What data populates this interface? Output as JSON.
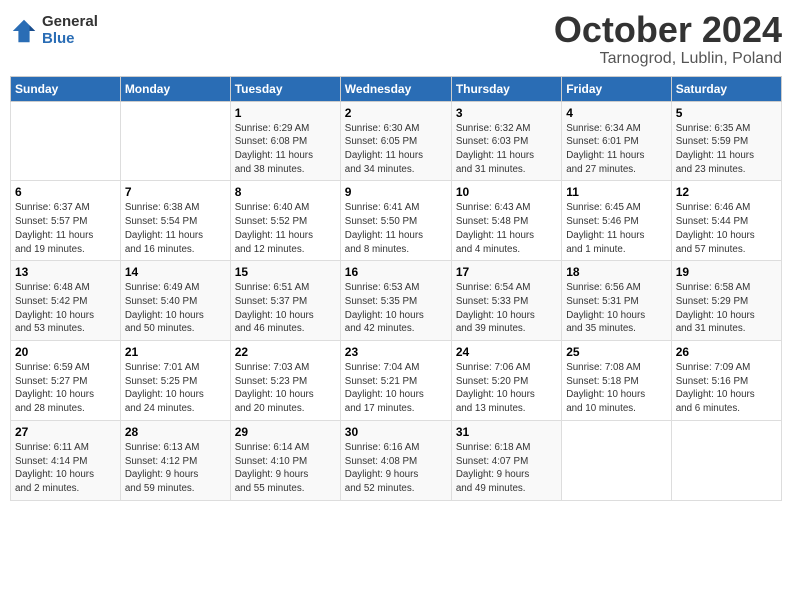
{
  "header": {
    "logo_general": "General",
    "logo_blue": "Blue",
    "title": "October 2024",
    "location": "Tarnogrod, Lublin, Poland"
  },
  "weekdays": [
    "Sunday",
    "Monday",
    "Tuesday",
    "Wednesday",
    "Thursday",
    "Friday",
    "Saturday"
  ],
  "weeks": [
    [
      {
        "day": "",
        "info": ""
      },
      {
        "day": "",
        "info": ""
      },
      {
        "day": "1",
        "info": "Sunrise: 6:29 AM\nSunset: 6:08 PM\nDaylight: 11 hours\nand 38 minutes."
      },
      {
        "day": "2",
        "info": "Sunrise: 6:30 AM\nSunset: 6:05 PM\nDaylight: 11 hours\nand 34 minutes."
      },
      {
        "day": "3",
        "info": "Sunrise: 6:32 AM\nSunset: 6:03 PM\nDaylight: 11 hours\nand 31 minutes."
      },
      {
        "day": "4",
        "info": "Sunrise: 6:34 AM\nSunset: 6:01 PM\nDaylight: 11 hours\nand 27 minutes."
      },
      {
        "day": "5",
        "info": "Sunrise: 6:35 AM\nSunset: 5:59 PM\nDaylight: 11 hours\nand 23 minutes."
      }
    ],
    [
      {
        "day": "6",
        "info": "Sunrise: 6:37 AM\nSunset: 5:57 PM\nDaylight: 11 hours\nand 19 minutes."
      },
      {
        "day": "7",
        "info": "Sunrise: 6:38 AM\nSunset: 5:54 PM\nDaylight: 11 hours\nand 16 minutes."
      },
      {
        "day": "8",
        "info": "Sunrise: 6:40 AM\nSunset: 5:52 PM\nDaylight: 11 hours\nand 12 minutes."
      },
      {
        "day": "9",
        "info": "Sunrise: 6:41 AM\nSunset: 5:50 PM\nDaylight: 11 hours\nand 8 minutes."
      },
      {
        "day": "10",
        "info": "Sunrise: 6:43 AM\nSunset: 5:48 PM\nDaylight: 11 hours\nand 4 minutes."
      },
      {
        "day": "11",
        "info": "Sunrise: 6:45 AM\nSunset: 5:46 PM\nDaylight: 11 hours\nand 1 minute."
      },
      {
        "day": "12",
        "info": "Sunrise: 6:46 AM\nSunset: 5:44 PM\nDaylight: 10 hours\nand 57 minutes."
      }
    ],
    [
      {
        "day": "13",
        "info": "Sunrise: 6:48 AM\nSunset: 5:42 PM\nDaylight: 10 hours\nand 53 minutes."
      },
      {
        "day": "14",
        "info": "Sunrise: 6:49 AM\nSunset: 5:40 PM\nDaylight: 10 hours\nand 50 minutes."
      },
      {
        "day": "15",
        "info": "Sunrise: 6:51 AM\nSunset: 5:37 PM\nDaylight: 10 hours\nand 46 minutes."
      },
      {
        "day": "16",
        "info": "Sunrise: 6:53 AM\nSunset: 5:35 PM\nDaylight: 10 hours\nand 42 minutes."
      },
      {
        "day": "17",
        "info": "Sunrise: 6:54 AM\nSunset: 5:33 PM\nDaylight: 10 hours\nand 39 minutes."
      },
      {
        "day": "18",
        "info": "Sunrise: 6:56 AM\nSunset: 5:31 PM\nDaylight: 10 hours\nand 35 minutes."
      },
      {
        "day": "19",
        "info": "Sunrise: 6:58 AM\nSunset: 5:29 PM\nDaylight: 10 hours\nand 31 minutes."
      }
    ],
    [
      {
        "day": "20",
        "info": "Sunrise: 6:59 AM\nSunset: 5:27 PM\nDaylight: 10 hours\nand 28 minutes."
      },
      {
        "day": "21",
        "info": "Sunrise: 7:01 AM\nSunset: 5:25 PM\nDaylight: 10 hours\nand 24 minutes."
      },
      {
        "day": "22",
        "info": "Sunrise: 7:03 AM\nSunset: 5:23 PM\nDaylight: 10 hours\nand 20 minutes."
      },
      {
        "day": "23",
        "info": "Sunrise: 7:04 AM\nSunset: 5:21 PM\nDaylight: 10 hours\nand 17 minutes."
      },
      {
        "day": "24",
        "info": "Sunrise: 7:06 AM\nSunset: 5:20 PM\nDaylight: 10 hours\nand 13 minutes."
      },
      {
        "day": "25",
        "info": "Sunrise: 7:08 AM\nSunset: 5:18 PM\nDaylight: 10 hours\nand 10 minutes."
      },
      {
        "day": "26",
        "info": "Sunrise: 7:09 AM\nSunset: 5:16 PM\nDaylight: 10 hours\nand 6 minutes."
      }
    ],
    [
      {
        "day": "27",
        "info": "Sunrise: 6:11 AM\nSunset: 4:14 PM\nDaylight: 10 hours\nand 2 minutes."
      },
      {
        "day": "28",
        "info": "Sunrise: 6:13 AM\nSunset: 4:12 PM\nDaylight: 9 hours\nand 59 minutes."
      },
      {
        "day": "29",
        "info": "Sunrise: 6:14 AM\nSunset: 4:10 PM\nDaylight: 9 hours\nand 55 minutes."
      },
      {
        "day": "30",
        "info": "Sunrise: 6:16 AM\nSunset: 4:08 PM\nDaylight: 9 hours\nand 52 minutes."
      },
      {
        "day": "31",
        "info": "Sunrise: 6:18 AM\nSunset: 4:07 PM\nDaylight: 9 hours\nand 49 minutes."
      },
      {
        "day": "",
        "info": ""
      },
      {
        "day": "",
        "info": ""
      }
    ]
  ]
}
